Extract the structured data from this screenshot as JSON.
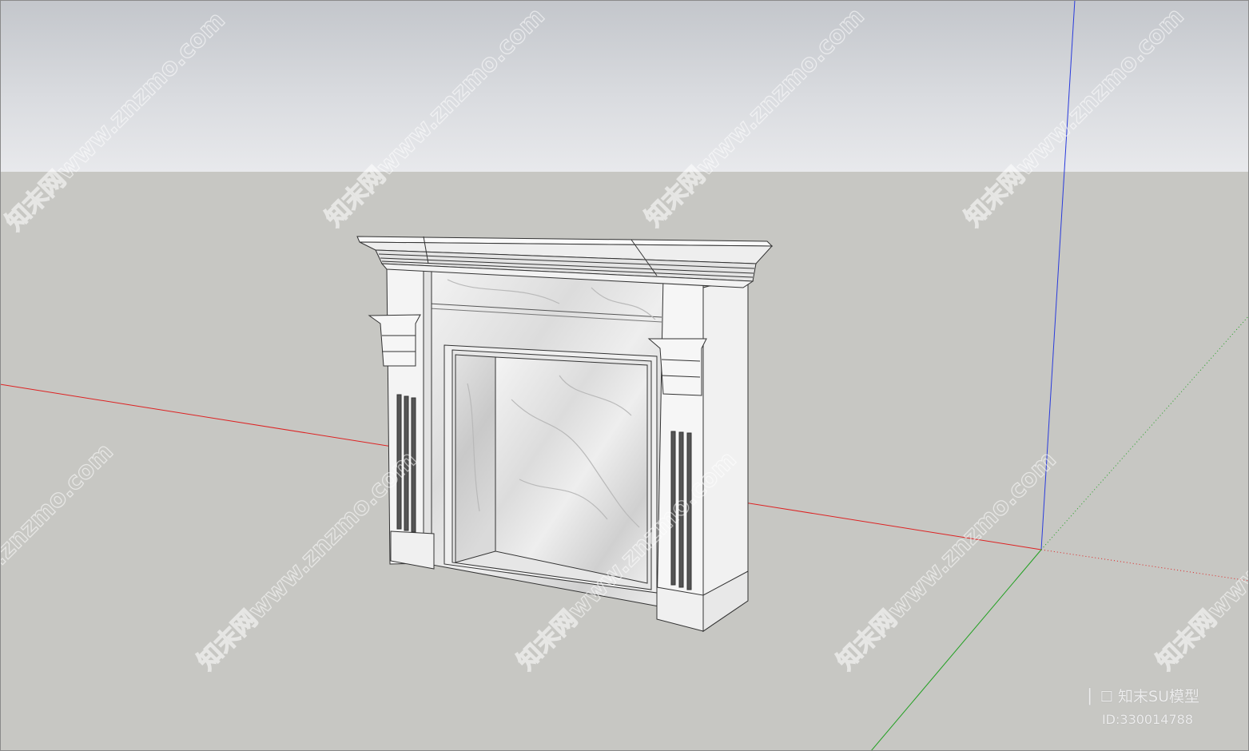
{
  "watermark": {
    "text": "知末网www.znzmo.com"
  },
  "brand": {
    "logo_glyph": "▏☐",
    "name": "知末SU模型",
    "model_id": "ID:330014788"
  },
  "scene": {
    "object": "fireplace-mantel",
    "material": "white marble",
    "sky_color": "#dcdee2",
    "ground_color": "#c7c7c3",
    "axis_colors": {
      "red": "#d11",
      "green": "#1a9a1a",
      "blue": "#2233dd"
    }
  }
}
